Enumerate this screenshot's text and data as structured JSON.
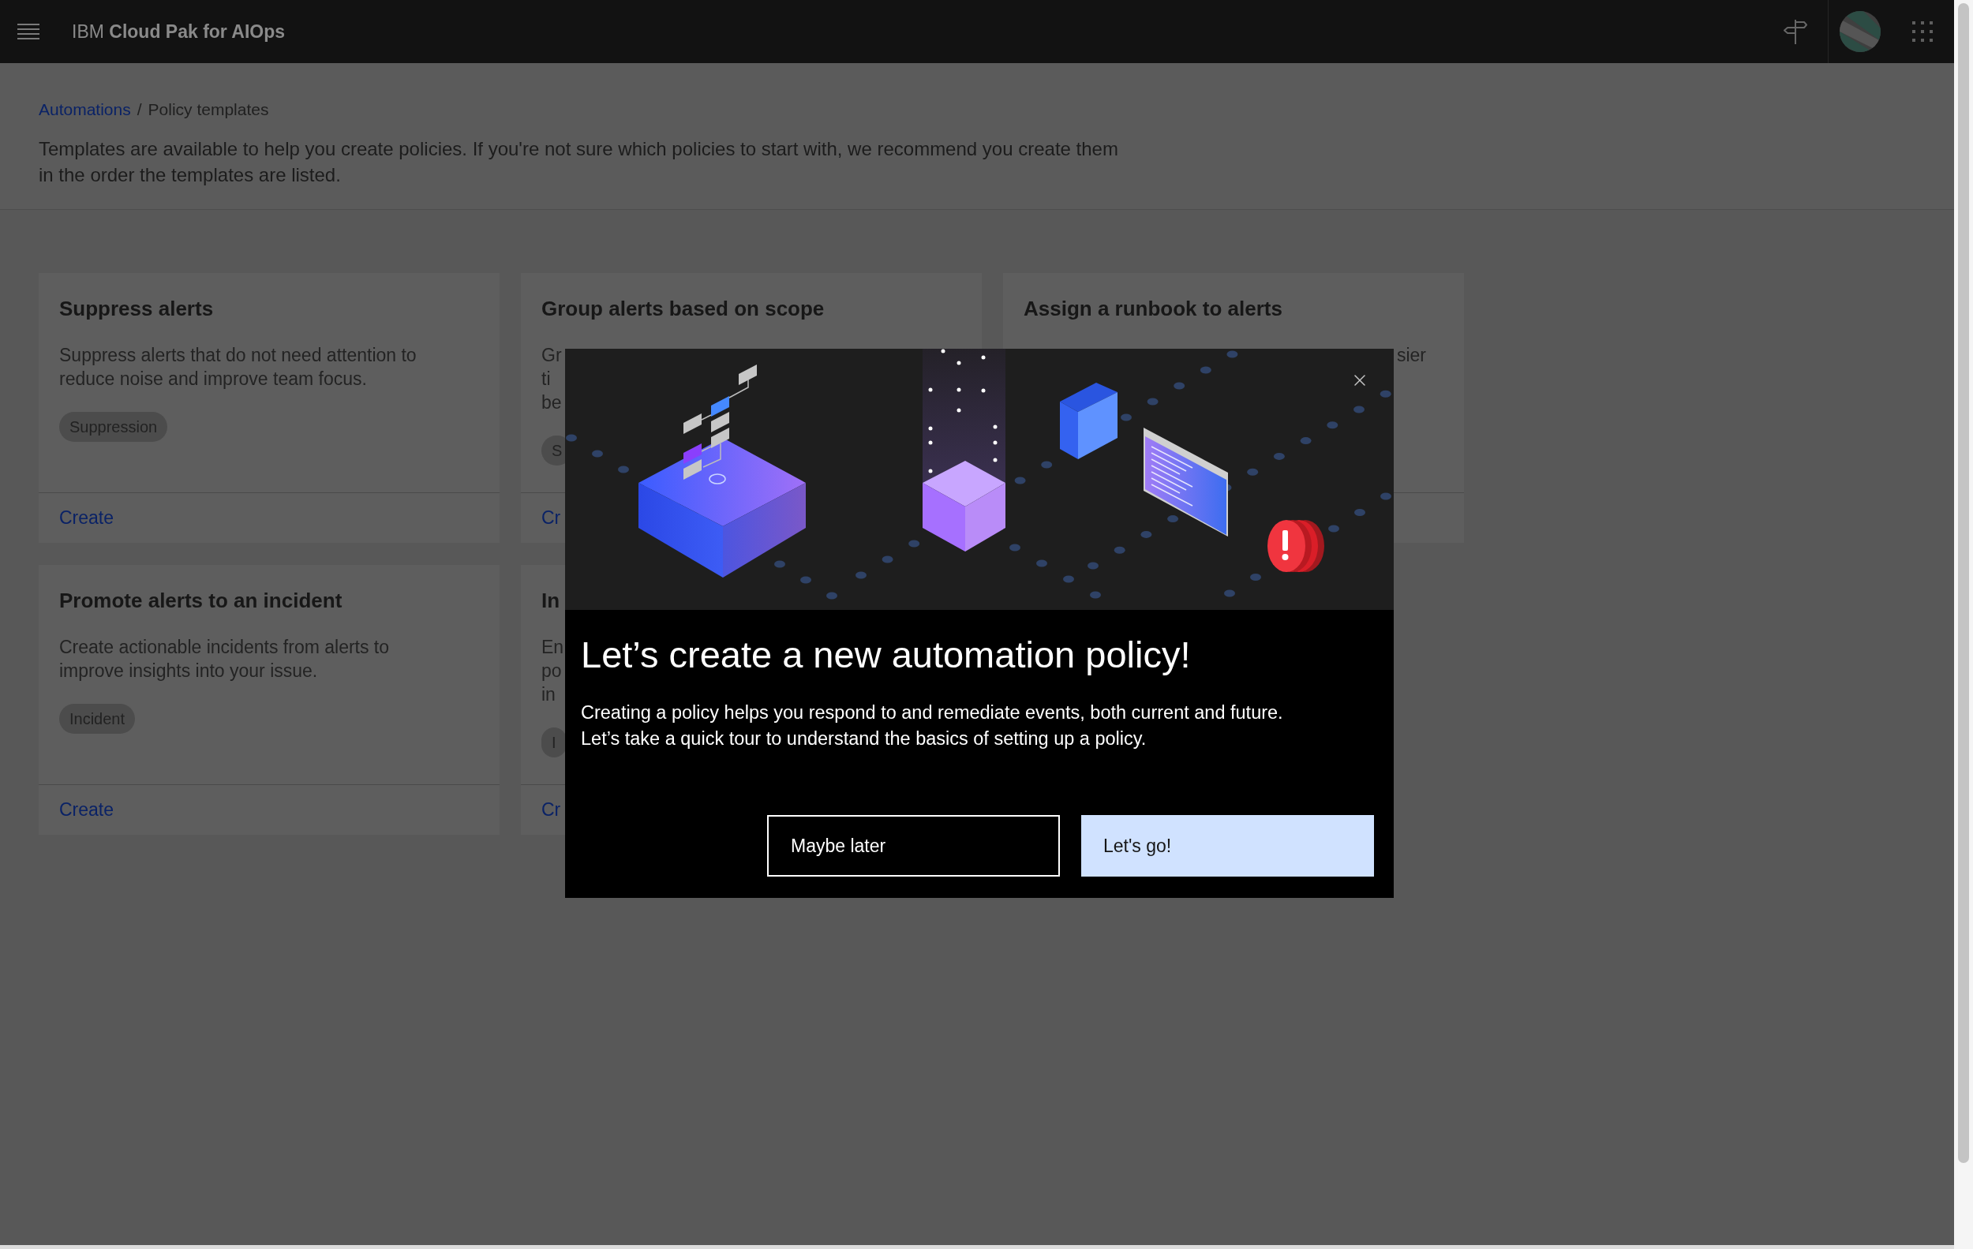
{
  "header": {
    "brand": "IBM **Cloud Pak for AIOps**"
  },
  "breadcrumb": {
    "items": [
      {
        "label": "Automations",
        "current": false
      },
      {
        "label": "Policy templates",
        "current": true
      }
    ],
    "separator": "/"
  },
  "description": "Templates are available to help you create policies. If you're not sure which policies to start with, we recommend you create them in the order the templates are listed.",
  "cards": [
    {
      "title": "Suppress alerts",
      "description": [
        "Suppress alerts that do not need attention to",
        "reduce noise and improve team focus."
      ],
      "tag": "Suppression",
      "link": "Create",
      "clipped_left": false
    },
    {
      "title": "Group alerts based on scope",
      "description": [
        "Gr",
        "ti",
        "be"
      ],
      "tag": "S",
      "link": "Cr",
      "clipped_left": false
    },
    {
      "title": "Assign a runbook to alerts",
      "description": [
        "sier"
      ],
      "clipped_left": true
    },
    {
      "title": "Promote alerts to an incident",
      "description": [
        "Create actionable incidents from alerts to",
        "improve insights into your issue."
      ],
      "tag": "Incident",
      "link": "Create",
      "clipped_left": false
    },
    {
      "title": "In",
      "description": [
        "En",
        "po",
        "in"
      ],
      "tag": "I",
      "link": "Cr",
      "clipped_left": false
    }
  ],
  "dialog": {
    "title": "Let’s create a new automation policy!",
    "body": [
      "Creating a policy helps you respond to and remediate events, both current and future.",
      "Let’s take a quick tour to understand the basics of setting up a policy."
    ],
    "buttons": [
      {
        "label": "Maybe later",
        "kind": "secondary"
      },
      {
        "label": "Let's go!",
        "kind": "primary"
      }
    ]
  }
}
